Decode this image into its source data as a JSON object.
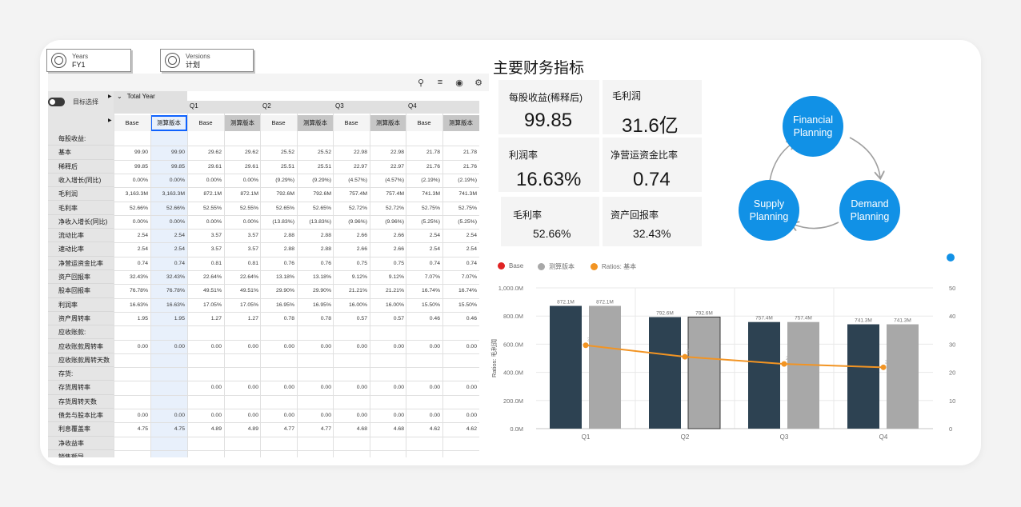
{
  "filters": {
    "years": {
      "label": "Years",
      "value": "FY1"
    },
    "versions": {
      "label": "Versions",
      "value": "计划"
    }
  },
  "toolbar": {
    "icons": [
      "hierarchy-icon",
      "filter-icon",
      "eye-icon",
      "settings-icon"
    ]
  },
  "grid": {
    "toggle_label": "目标选择",
    "total_year_label": "Total Year",
    "quarters": [
      "Q1",
      "Q2",
      "Q3",
      "Q4"
    ],
    "col_base": "Base",
    "col_version": "测算版本",
    "rows": [
      {
        "label": "每股收益:",
        "values": [
          "",
          "",
          "",
          "",
          "",
          "",
          "",
          "",
          "",
          ""
        ]
      },
      {
        "label": "基本",
        "values": [
          "99.90",
          "99.90",
          "29.62",
          "29.62",
          "25.52",
          "25.52",
          "22.98",
          "22.98",
          "21.78",
          "21.78"
        ]
      },
      {
        "label": "稀释后",
        "values": [
          "99.85",
          "99.85",
          "29.61",
          "29.61",
          "25.51",
          "25.51",
          "22.97",
          "22.97",
          "21.76",
          "21.76"
        ]
      },
      {
        "label": "收入增长(同比)",
        "values": [
          "0.00%",
          "0.00%",
          "0.00%",
          "0.00%",
          "(9.29%)",
          "(9.29%)",
          "(4.57%)",
          "(4.57%)",
          "(2.19%)",
          "(2.19%)"
        ]
      },
      {
        "label": "毛利润",
        "values": [
          "3,163.3M",
          "3,163.3M",
          "872.1M",
          "872.1M",
          "792.6M",
          "792.6M",
          "757.4M",
          "757.4M",
          "741.3M",
          "741.3M"
        ]
      },
      {
        "label": "毛利率",
        "values": [
          "52.66%",
          "52.66%",
          "52.55%",
          "52.55%",
          "52.65%",
          "52.65%",
          "52.72%",
          "52.72%",
          "52.75%",
          "52.75%"
        ]
      },
      {
        "label": "净收入增长(同比)",
        "values": [
          "0.00%",
          "0.00%",
          "0.00%",
          "0.00%",
          "(13.83%)",
          "(13.83%)",
          "(9.96%)",
          "(9.96%)",
          "(5.25%)",
          "(5.25%)"
        ]
      },
      {
        "label": "流动比率",
        "values": [
          "2.54",
          "2.54",
          "3.57",
          "3.57",
          "2.88",
          "2.88",
          "2.66",
          "2.66",
          "2.54",
          "2.54"
        ]
      },
      {
        "label": "速动比率",
        "values": [
          "2.54",
          "2.54",
          "3.57",
          "3.57",
          "2.88",
          "2.88",
          "2.66",
          "2.66",
          "2.54",
          "2.54"
        ]
      },
      {
        "label": "净营运资金比率",
        "values": [
          "0.74",
          "0.74",
          "0.81",
          "0.81",
          "0.76",
          "0.76",
          "0.75",
          "0.75",
          "0.74",
          "0.74"
        ]
      },
      {
        "label": "资产回报率",
        "values": [
          "32.43%",
          "32.43%",
          "22.64%",
          "22.64%",
          "13.18%",
          "13.18%",
          "9.12%",
          "9.12%",
          "7.07%",
          "7.07%"
        ]
      },
      {
        "label": "股本回报率",
        "values": [
          "76.78%",
          "76.78%",
          "49.51%",
          "49.51%",
          "29.90%",
          "29.90%",
          "21.21%",
          "21.21%",
          "16.74%",
          "16.74%"
        ]
      },
      {
        "label": "利润率",
        "values": [
          "16.63%",
          "16.63%",
          "17.05%",
          "17.05%",
          "16.95%",
          "16.95%",
          "16.00%",
          "16.00%",
          "15.50%",
          "15.50%"
        ]
      },
      {
        "label": "资产周转率",
        "values": [
          "1.95",
          "1.95",
          "1.27",
          "1.27",
          "0.78",
          "0.78",
          "0.57",
          "0.57",
          "0.46",
          "0.46"
        ]
      },
      {
        "label": "应收账款:",
        "values": [
          "",
          "",
          "",
          "",
          "",
          "",
          "",
          "",
          "",
          ""
        ]
      },
      {
        "label": "应收账款周转率",
        "values": [
          "0.00",
          "0.00",
          "0.00",
          "0.00",
          "0.00",
          "0.00",
          "0.00",
          "0.00",
          "0.00",
          "0.00"
        ]
      },
      {
        "label": "应收账款周转天数",
        "values": [
          "",
          "",
          "",
          "",
          "",
          "",
          "",
          "",
          "",
          ""
        ]
      },
      {
        "label": "存货:",
        "values": [
          "",
          "",
          "",
          "",
          "",
          "",
          "",
          "",
          "",
          ""
        ]
      },
      {
        "label": "存货周转率",
        "values": [
          "",
          "",
          "0.00",
          "0.00",
          "0.00",
          "0.00",
          "0.00",
          "0.00",
          "0.00",
          "0.00"
        ]
      },
      {
        "label": "存货周转天数",
        "values": [
          "",
          "",
          "",
          "",
          "",
          "",
          "",
          "",
          "",
          ""
        ]
      },
      {
        "label": "债务与股本比率",
        "values": [
          "0.00",
          "0.00",
          "0.00",
          "0.00",
          "0.00",
          "0.00",
          "0.00",
          "0.00",
          "0.00",
          "0.00"
        ]
      },
      {
        "label": "利息覆盖率",
        "values": [
          "4.75",
          "4.75",
          "4.89",
          "4.89",
          "4.77",
          "4.77",
          "4.68",
          "4.68",
          "4.62",
          "4.62"
        ]
      },
      {
        "label": "净收益率",
        "values": [
          "",
          "",
          "",
          "",
          "",
          "",
          "",
          "",
          "",
          ""
        ]
      },
      {
        "label": "销售额导",
        "values": [
          "",
          "",
          "",
          "",
          "",
          "",
          "",
          "",
          "",
          ""
        ]
      }
    ]
  },
  "kpi": {
    "title": "主要财务指标",
    "cards": [
      {
        "label": "每股收益(稀释后)",
        "value": "99.85"
      },
      {
        "label": "毛利润",
        "value": "31.6亿"
      },
      {
        "label": "利润率",
        "value": "16.63%"
      },
      {
        "label": "净营运资金比率",
        "value": "0.74"
      },
      {
        "label": "毛利率",
        "value": "52.66%"
      },
      {
        "label": "资产回报率",
        "value": "32.43%"
      }
    ]
  },
  "cycle": {
    "nodes": [
      "Financial Planning",
      "Demand Planning",
      "Supply Planning"
    ],
    "color": "#1191e6"
  },
  "chart_data": {
    "type": "bar",
    "categories": [
      "Q1",
      "Q2",
      "Q3",
      "Q4"
    ],
    "series": [
      {
        "name": "Base",
        "values": [
          872.1,
          792.6,
          757.4,
          741.3
        ],
        "labels": [
          "872.1M",
          "792.6M",
          "757.4M",
          "741.3M"
        ],
        "color": "#2d4252"
      },
      {
        "name": "测算版本",
        "values": [
          872.1,
          792.6,
          757.4,
          741.3
        ],
        "labels": [
          "872.1M",
          "792.6M",
          "757.4M",
          "741.3M"
        ],
        "color": "#a8a8a8"
      },
      {
        "name": "Ratios: 基本",
        "type": "line",
        "values": [
          29.62,
          25.52,
          22.98,
          21.78
        ],
        "labels": [
          "29.62",
          "25.52",
          "22.98",
          "21.78"
        ],
        "color": "#f29423",
        "axis": "right"
      }
    ],
    "legend_colors": [
      "#e02424",
      "#a8a8a8",
      "#f29423"
    ],
    "ylabel": "Ratios: 毛利润",
    "ylim": [
      0,
      1000
    ],
    "yticks": [
      "0.0M",
      "200.0M",
      "400.0M",
      "600.0M",
      "800.0M",
      "1,000.0M"
    ],
    "y2lim": [
      0,
      50
    ],
    "y2ticks": [
      "0",
      "10",
      "20",
      "30",
      "40",
      "50"
    ],
    "legend_position": "top-left"
  }
}
